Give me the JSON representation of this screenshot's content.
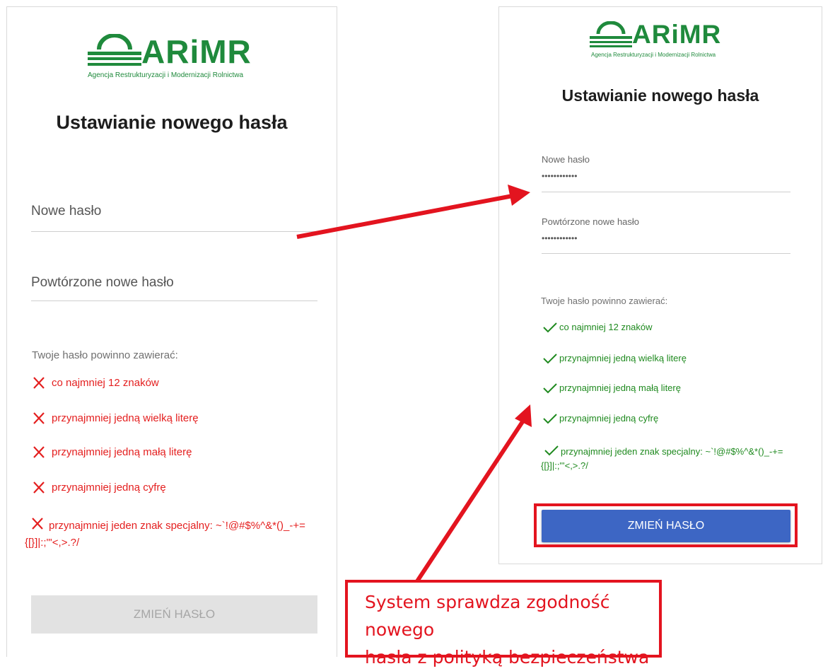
{
  "left_panel": {
    "logo_word": "ARiMR",
    "logo_subtitle": "Agencja Restrukturyzacji i Modernizacji Rolnictwa",
    "title": "Ustawianie nowego hasła",
    "new_password_placeholder": "Nowe hasło",
    "repeat_password_placeholder": "Powtórzone nowe hasło",
    "requirements_heading": "Twoje hasło powinno zawierać:",
    "requirements": [
      "co najmniej 12 znaków",
      "przynajmniej jedną wielką literę",
      "przynajmniej jedną małą literę",
      "przynajmniej jedną cyfrę",
      "przynajmniej jeden znak specjalny: ~`!@#$%^&*()_-+= {[}]|:;\"'<,>.?/"
    ],
    "button_label": "ZMIEŃ HASŁO",
    "button_state": "disabled"
  },
  "right_panel": {
    "logo_word": "ARiMR",
    "logo_subtitle": "Agencja Restrukturyzacji i Modernizacji Rolnictwa",
    "title": "Ustawianie nowego hasła",
    "new_password_label": "Nowe hasło",
    "new_password_value": "••••••••••••",
    "repeat_password_label": "Powtórzone nowe hasło",
    "repeat_password_value": "••••••••••••",
    "requirements_heading": "Twoje hasło powinno zawierać:",
    "requirements": [
      "co najmniej 12 znaków",
      "przynajmniej jedną wielką literę",
      "przynajmniej jedną małą literę",
      "przynajmniej jedną cyfrę",
      "przynajmniej jeden znak specjalny: ~`!@#$%^&*()_-+= {[}]|:;\"'<,>.?/"
    ],
    "button_label": "ZMIEŃ HASŁO",
    "button_state": "enabled"
  },
  "callout": {
    "line1": "System sprawdza zgodność nowego",
    "line2": "hasła z polityką bezpieczeństwa"
  },
  "icons": {
    "fail": "cross-icon",
    "ok": "check-icon"
  },
  "colors": {
    "brand_green": "#1f8a3c",
    "fail_red": "#e41f1f",
    "ok_green": "#1f8a1f",
    "button_blue": "#3d66c4",
    "annotation_red": "#e3141f"
  }
}
